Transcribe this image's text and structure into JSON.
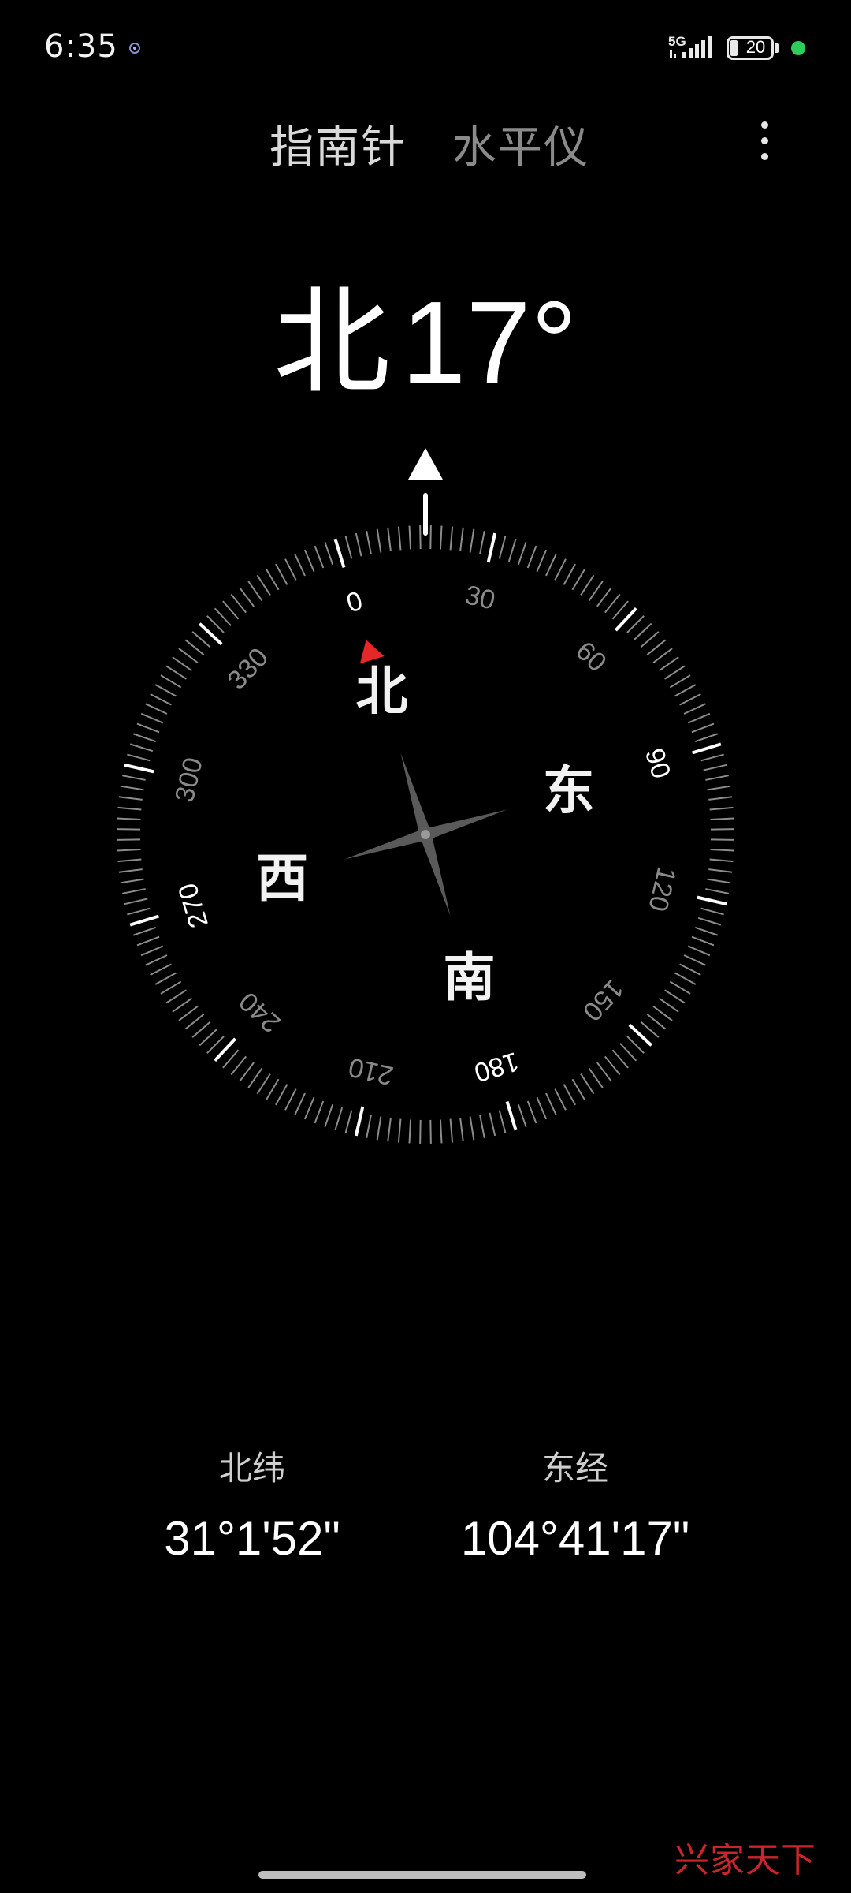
{
  "status_bar": {
    "time": "6:35",
    "network": "5G",
    "battery": "20"
  },
  "tabs": [
    {
      "label": "指南针",
      "active": true
    },
    {
      "label": "水平仪",
      "active": false
    }
  ],
  "heading": {
    "direction": "北",
    "degrees": 17,
    "degrees_label": "17°"
  },
  "compass": {
    "cardinals": {
      "north": "北",
      "east": "东",
      "south": "南",
      "west": "西"
    },
    "ring_labels": [
      "0",
      "30",
      "60",
      "90",
      "120",
      "150",
      "180",
      "210",
      "240",
      "270",
      "300",
      "330"
    ],
    "north_marker_color": "#e62727"
  },
  "coordinates": {
    "latitude_label": "北纬",
    "latitude_value": "31°1'52\"",
    "longitude_label": "东经",
    "longitude_value": "104°41'17\""
  },
  "watermark": "兴家天下"
}
